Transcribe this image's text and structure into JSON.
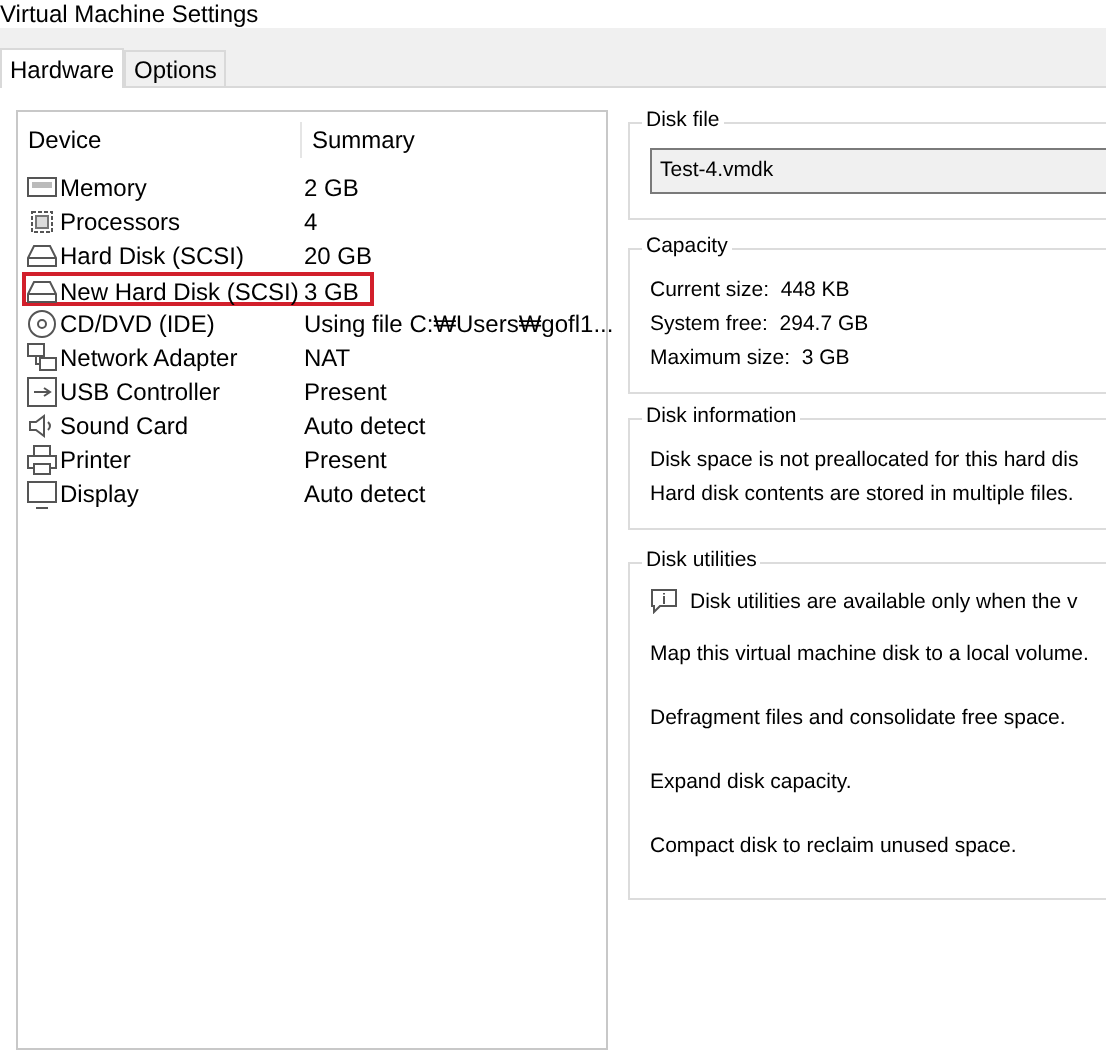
{
  "window": {
    "title": "Virtual Machine Settings"
  },
  "tabs": [
    {
      "label": "Hardware",
      "selected": true
    },
    {
      "label": "Options",
      "selected": false
    }
  ],
  "device_list": {
    "columns": [
      "Device",
      "Summary"
    ],
    "rows": [
      {
        "kind": "memory",
        "device": "Memory",
        "summary": "2 GB",
        "highlighted": false
      },
      {
        "kind": "processor",
        "device": "Processors",
        "summary": "4",
        "highlighted": false
      },
      {
        "kind": "disk",
        "device": "Hard Disk (SCSI)",
        "summary": "20 GB",
        "highlighted": false
      },
      {
        "kind": "disk",
        "device": "New Hard Disk (SCSI)",
        "summary": "3 GB",
        "highlighted": true
      },
      {
        "kind": "cd",
        "device": "CD/DVD (IDE)",
        "summary": "Using file C:₩Users₩gofl1...",
        "highlighted": false
      },
      {
        "kind": "network",
        "device": "Network Adapter",
        "summary": "NAT",
        "highlighted": false
      },
      {
        "kind": "usb",
        "device": "USB Controller",
        "summary": "Present",
        "highlighted": false
      },
      {
        "kind": "sound",
        "device": "Sound Card",
        "summary": "Auto detect",
        "highlighted": false
      },
      {
        "kind": "printer",
        "device": "Printer",
        "summary": "Present",
        "highlighted": false
      },
      {
        "kind": "display",
        "device": "Display",
        "summary": "Auto detect",
        "highlighted": false
      }
    ]
  },
  "disk_file": {
    "title": "Disk file",
    "value": "Test-4.vmdk"
  },
  "capacity": {
    "title": "Capacity",
    "lines": [
      "Current size:  448 KB",
      "System free:  294.7 GB",
      "Maximum size:  3 GB"
    ]
  },
  "disk_information": {
    "title": "Disk information",
    "lines": [
      "Disk space is not preallocated for this hard dis",
      "Hard disk contents are stored in multiple files."
    ]
  },
  "disk_utilities": {
    "title": "Disk utilities",
    "notice": "Disk utilities are available only when the v",
    "actions": [
      "Map this virtual machine disk to a local volume.",
      "Defragment files and consolidate free space.",
      "Expand disk capacity.",
      "Compact disk to reclaim unused space."
    ]
  }
}
